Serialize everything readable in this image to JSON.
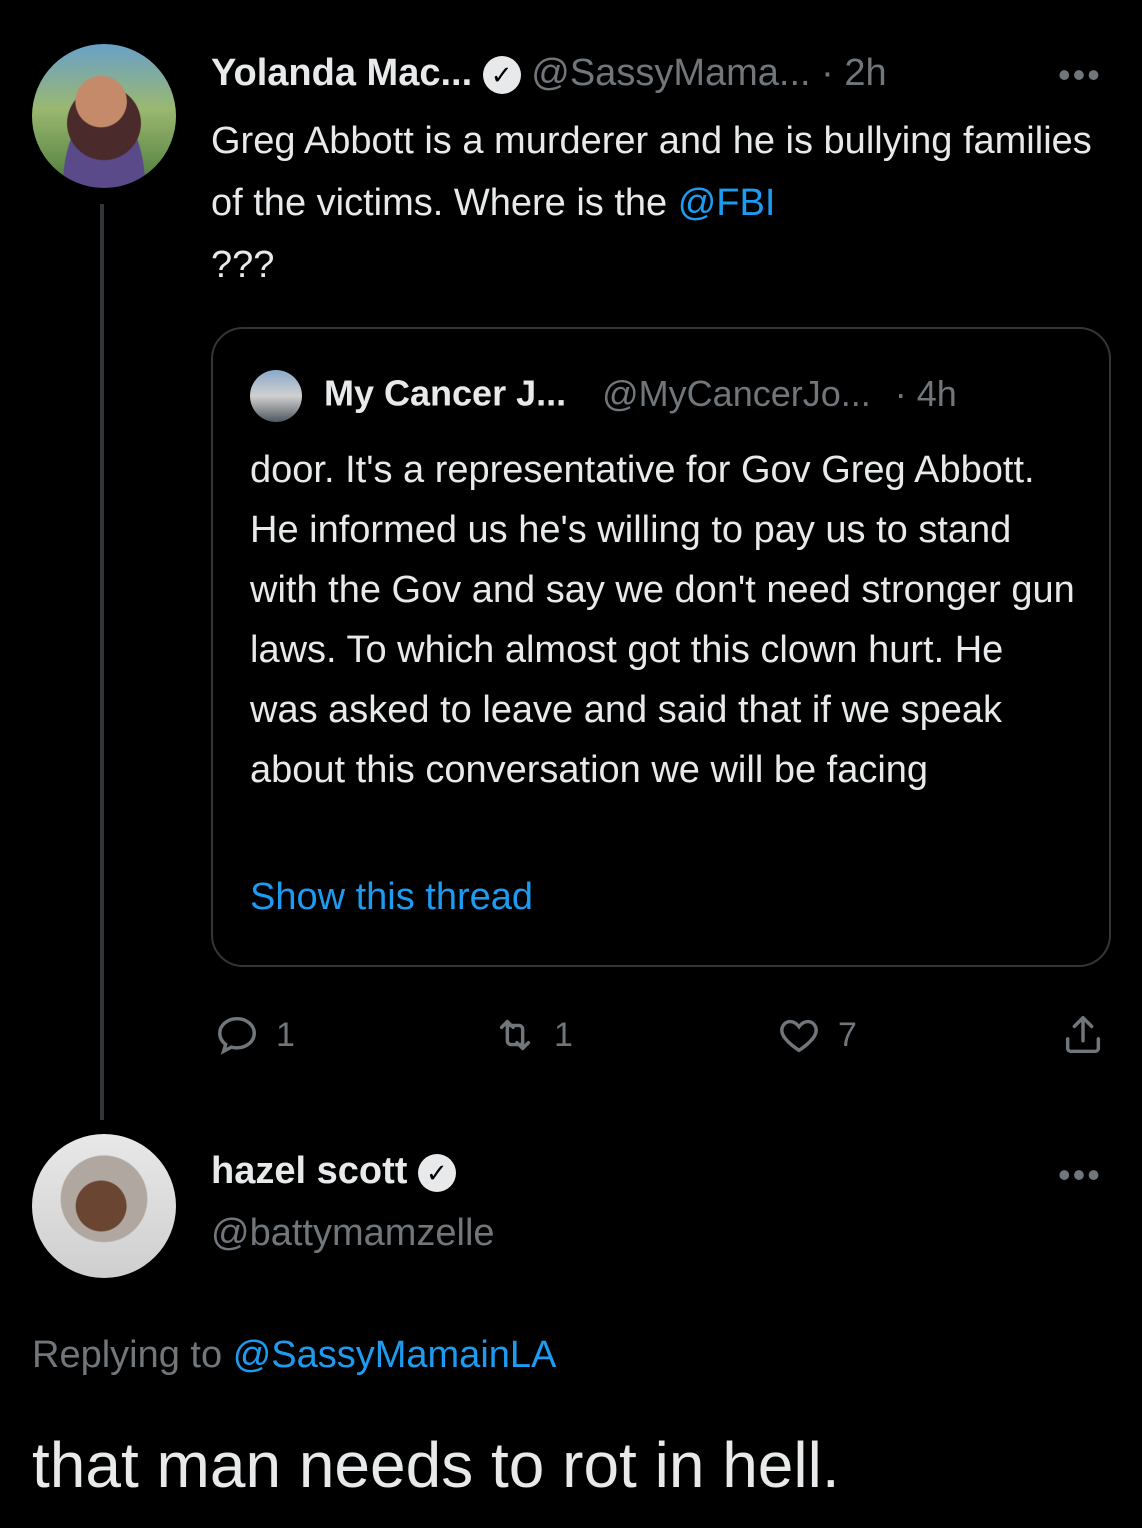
{
  "tweet": {
    "author_name": "Yolanda Mac...",
    "handle": "@SassyMama...",
    "time": "· 2h",
    "more": "•••",
    "text_part1": "Greg Abbott is a murderer and he is bullying families of the victims. Where is the",
    "mention": "@FBI",
    "text_part2": "???",
    "quote": {
      "author_name": "My Cancer J...",
      "handle": "@MyCancerJo...",
      "time": "· 4h",
      "text": "door. It's a representative for Gov Greg Abbott. He informed us he's willing to pay us to stand with the Gov and say we don't need stronger gun laws. To which almost got this clown hurt. He was asked to leave and said that if we speak about this conversation we will be facing",
      "show_thread": "Show this thread"
    },
    "actions": {
      "reply_count": "1",
      "retweet_count": "1",
      "like_count": "7"
    }
  },
  "reply": {
    "author_name": "hazel scott",
    "handle": "@battymamzelle",
    "more": "•••",
    "replying_prefix": "Replying to",
    "replying_to": "@SassyMamainLA",
    "text": "that man needs to rot in hell."
  },
  "icons": {
    "verified": "verified-badge-icon",
    "reply": "reply-icon",
    "retweet": "retweet-icon",
    "like": "heart-icon",
    "share": "share-icon"
  },
  "colors": {
    "background": "#000000",
    "text": "#e7e9ea",
    "muted": "#71767b",
    "link": "#1d9bf0",
    "border": "#333639"
  }
}
